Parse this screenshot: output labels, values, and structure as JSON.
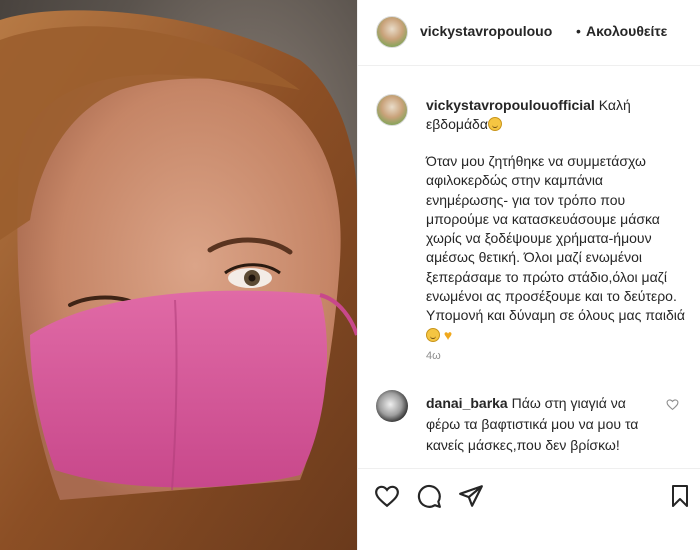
{
  "header": {
    "username": "vickystavropoulouo",
    "separator": "•",
    "follow_label": "Ακολουθείτε"
  },
  "post": {
    "caption_username": "vickystavropoulouofficial",
    "caption_title": "Καλή εβδομάδα",
    "caption_body": "Όταν μου ζητήθηκε να συμμετάσχω αφιλοκερδώς στην καμπάνια ενημέρωσης- για τον τρόπο που μπορούμε να κατασκευάσουμε μάσκα χωρίς να ξοδέψουμε χρήματα-ήμουν αμέσως θετική. Όλοι μαζί ενωμένοι ξεπεράσαμε το πρώτο στάδιο,όλοι μαζί ενωμένοι ας προσέξουμε και το δεύτερο. Υπομονή και δύναμη σε όλους μας παιδιά",
    "time_ago": "4ω"
  },
  "comment": {
    "username": "danai_barka",
    "text": "Πάω στη γιαγιά να φέρω τα βαφτιστικά μου να μου τα κανείς μάσκες,που δεν βρίσκω!"
  },
  "icons": {
    "like": "heart-icon",
    "comment": "comment-icon",
    "share": "share-icon",
    "save": "bookmark-icon"
  },
  "colors": {
    "mask": "#d5589a",
    "hair": "#9a5a2a",
    "skin": "#c98b6d"
  }
}
